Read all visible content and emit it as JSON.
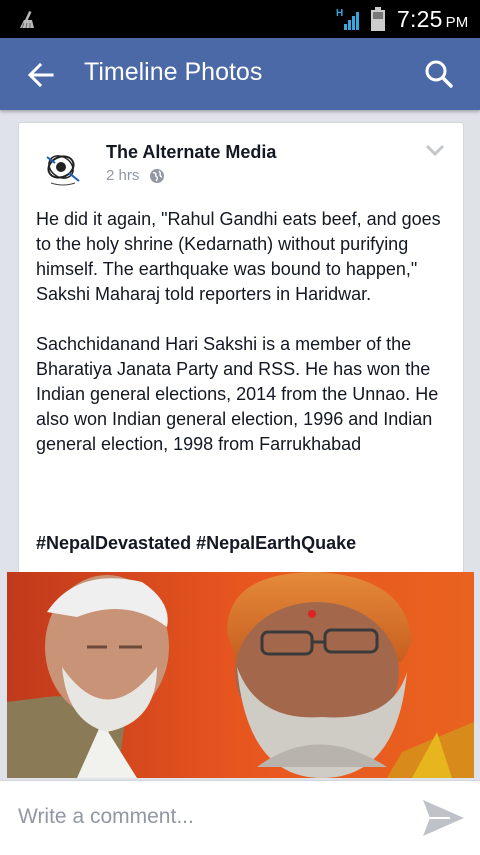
{
  "status_bar": {
    "time": "7:25",
    "ampm": "PM",
    "network_label": "H",
    "icons": [
      "clean-icon",
      "signal-icon",
      "battery-icon"
    ]
  },
  "app_bar": {
    "title": "Timeline Photos",
    "back_icon": "back-arrow-icon",
    "search_icon": "search-icon",
    "color": "#4a69a6"
  },
  "post": {
    "page_name": "The Alternate Media",
    "time_ago": "2 hrs",
    "privacy_icon": "globe-icon",
    "menu_icon": "chevron-down-icon",
    "paragraphs": [
      "He did it again, \"Rahul Gandhi eats beef, and goes to the holy shrine (Kedarnath) without purifying himself. The earthquake was bound to happen,\" Sakshi Maharaj told reporters in Haridwar.",
      "Sachchidanand Hari Sakshi is a member of the Bharatiya Janata Party and RSS. He has won the Indian general elections, 2014 from the Unnao. He also won Indian general election, 1996 and Indian general election, 1998 from Farrukhabad"
    ],
    "hashtags": [
      "#NepalDevastated",
      "#NepalEarthQuake"
    ]
  },
  "comment_bar": {
    "placeholder": "Write a comment...",
    "value": "",
    "send_icon": "send-icon"
  }
}
